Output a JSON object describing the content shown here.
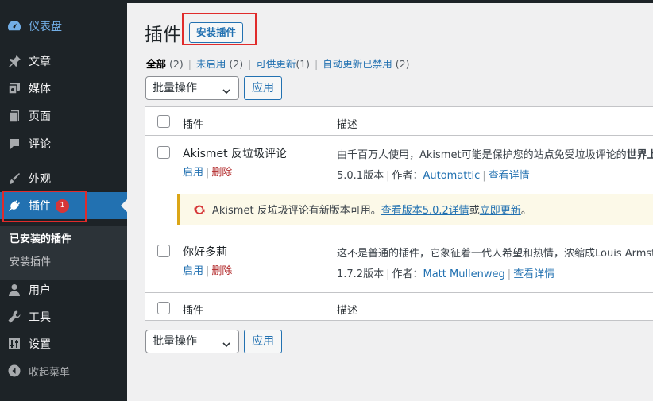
{
  "sidebar": {
    "dashboard": "仪表盘",
    "items": [
      "文章",
      "媒体",
      "页面",
      "评论",
      "外观",
      "插件",
      "用户",
      "工具",
      "设置",
      "收起菜单"
    ],
    "plugins_badge": "1",
    "submenu": {
      "installed": "已安装的插件",
      "add": "安装插件"
    }
  },
  "header": {
    "title": "插件",
    "add_new": "安装插件"
  },
  "filters": {
    "all": "全部",
    "all_count": "(2)",
    "inactive": "未启用",
    "inactive_count": "(2)",
    "updates": "可供更新",
    "updates_count": "(1)",
    "autoupdate_disabled": "自动更新已禁用",
    "autoupdate_count": "(2)"
  },
  "bulk": {
    "label": "批量操作",
    "apply": "应用"
  },
  "table": {
    "col_plugin": "插件",
    "col_desc": "描述",
    "plugins": [
      {
        "name": "Akismet 反垃圾评论",
        "activate": "启用",
        "delete": "删除",
        "desc_plain": "由千百万人使用，Akismet可能是保护您的站点免受垃圾评论的",
        "desc_bold": "世界上最",
        "version": "5.0.1版本",
        "author_prefix": "作者：",
        "author": "Automattic",
        "details": "查看详情"
      },
      {
        "name": "你好多莉",
        "activate": "启用",
        "delete": "删除",
        "desc_plain": "这不是普通的插件，它象征着一代人希望和热情，浓缩成Louis Armstro",
        "version": "1.7.2版本",
        "author_prefix": "作者：",
        "author": "Matt Mullenweg",
        "details": "查看详情"
      }
    ],
    "update_notice": {
      "text": "Akismet 反垃圾评论有新版本可用。",
      "view_link": "查看版本5.0.2详情",
      "or": "或",
      "update_link": "立即更新",
      "end": "。"
    }
  },
  "colors": {
    "accent": "#2271b1",
    "sidebar_bg": "#1d2327",
    "badge": "#d63638",
    "highlight_box": "#e02b2b",
    "notice_border": "#dba617",
    "update_icon": "#d63638"
  }
}
